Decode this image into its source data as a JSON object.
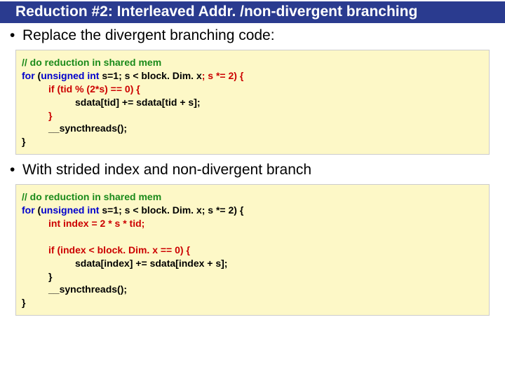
{
  "title": "Reduction #2: Interleaved Addr. /non-divergent branching",
  "bullet1": "Replace the divergent branching code:",
  "bullet2": "With strided index and non-divergent branch",
  "code1": {
    "c1": "// do reduction in shared mem",
    "l1a": "for",
    "l1b": " (",
    "l1c": "unsigned int",
    "l1d": " s=1; s < block. Dim. x",
    "l1e": "; s *= 2) {",
    "l2a": "if (tid % (2*s) == 0) {",
    "l3a": "sdata[tid] += sdata[tid + s];",
    "l4a": "}",
    "l5a": "__syncthreads();",
    "l6a": "}"
  },
  "code2": {
    "c1": "// do reduction in shared mem",
    "l1a": "for",
    "l1b": " (",
    "l1c": "unsigned int",
    "l1d": " s=1; s < block. Dim. x",
    "l1e": "; s *= 2) {",
    "l2a": "int index  = 2 * s * tid;",
    "l3a": "if (index < block. Dim. x == 0) {",
    "l4a": "sdata[index] += sdata[index + s];",
    "l5a": "}",
    "l6a": "__syncthreads();",
    "l7a": "}"
  }
}
